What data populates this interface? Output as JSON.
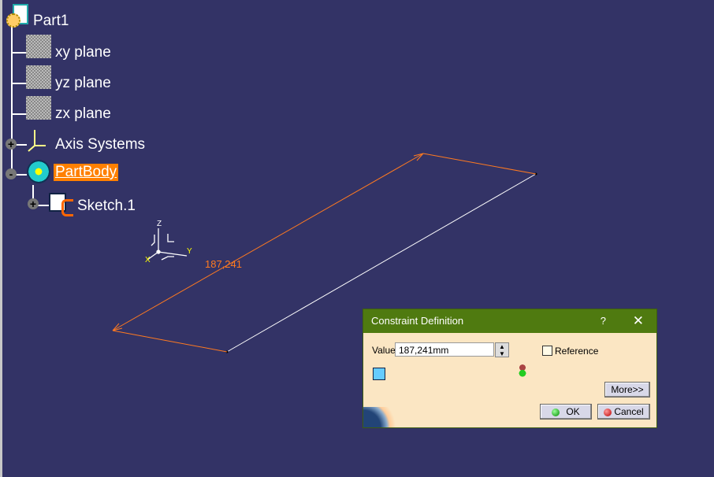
{
  "tree": {
    "items": [
      {
        "label": "Part1",
        "icon": "part-icon"
      },
      {
        "label": "xy plane",
        "icon": "plane-icon"
      },
      {
        "label": "yz plane",
        "icon": "plane-icon"
      },
      {
        "label": "zx plane",
        "icon": "plane-icon"
      },
      {
        "label": "Axis Systems",
        "icon": "axis-system-icon",
        "expander": "+"
      },
      {
        "label": "PartBody",
        "icon": "body-icon",
        "expander": "-",
        "selected": true
      },
      {
        "label": "Sketch.1",
        "icon": "sketch-icon",
        "expander": "+"
      }
    ]
  },
  "viewport": {
    "dimension_label": "187,241",
    "axis_labels": {
      "z": "Z",
      "x": "X",
      "y": "Y"
    },
    "dimension_color": "#ff8000"
  },
  "dialog": {
    "title": "Constraint Definition",
    "help": "?",
    "close": "✕",
    "value_label": "Value",
    "value": "187,241mm",
    "reference_label": "Reference",
    "reference_checked": false,
    "more_label": "More>>",
    "ok_label": "OK",
    "cancel_label": "Cancel",
    "header_color": "#4f7a10"
  }
}
